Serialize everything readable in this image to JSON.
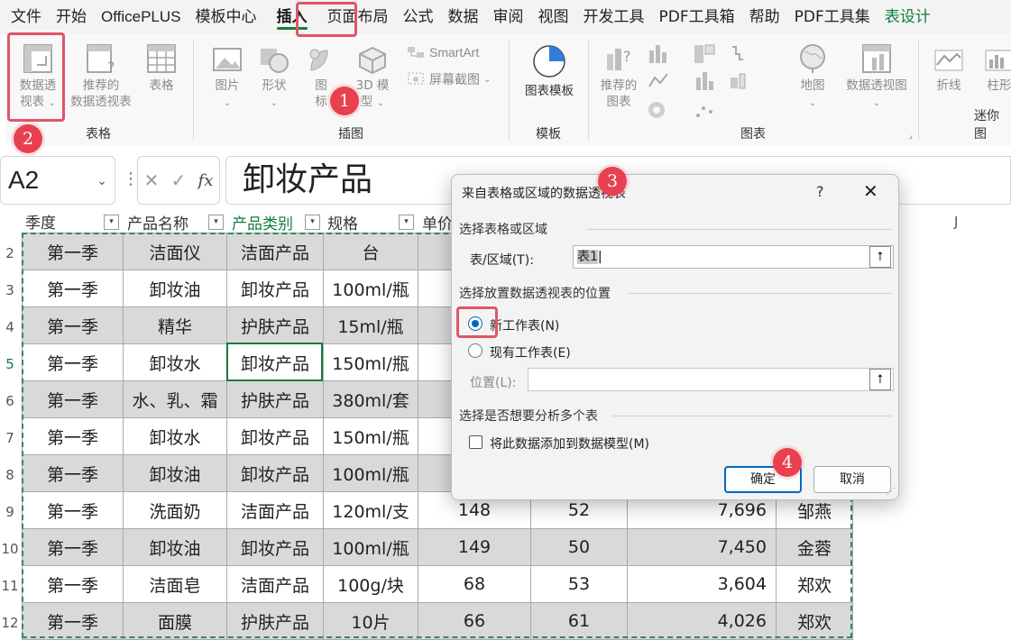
{
  "menu": {
    "items": [
      "文件",
      "开始",
      "OfficePLUS",
      "模板中心",
      "插入",
      "页面布局",
      "公式",
      "数据",
      "审阅",
      "视图",
      "开发工具",
      "PDF工具箱",
      "帮助",
      "PDF工具集",
      "表设计"
    ],
    "active": "插入"
  },
  "ribbon": {
    "table_group": {
      "label": "表格",
      "pivot_btn": [
        "数据透",
        "视表"
      ],
      "rec_pivot_btn": [
        "推荐的",
        "数据透视表"
      ],
      "table_btn": "表格"
    },
    "illustrations_group": {
      "label": "插图",
      "picture": "图片",
      "shapes": "形状",
      "icons": [
        "图",
        "标"
      ],
      "model3d": [
        "3D 模",
        "型"
      ],
      "smartart": "SmartArt",
      "screenshot": "屏幕截图"
    },
    "template_group": {
      "label": "模板",
      "chart_template": "图表模板"
    },
    "charts_group": {
      "label": "图表",
      "rec_charts": [
        "推荐的",
        "图表"
      ],
      "map": "地图",
      "pivot_chart": "数据透视图"
    },
    "sparkline_group": {
      "label": "迷你图",
      "line": "折线",
      "column": "柱形"
    }
  },
  "formula_bar": {
    "name_box": "A2",
    "fx": "fx",
    "content": "卸妆产品"
  },
  "sheet": {
    "col_headers": [
      "季度",
      "产品名称",
      "产品类别",
      "规格",
      "单价"
    ],
    "col_j": "J",
    "row_numbers": [
      "2",
      "3",
      "4",
      "5",
      "6",
      "7",
      "8",
      "9",
      "10",
      "11",
      "12"
    ],
    "rows": [
      [
        "第一季",
        "洁面仪",
        "洁面产品",
        "台",
        "",
        "",
        "",
        ""
      ],
      [
        "第一季",
        "卸妆油",
        "卸妆产品",
        "100ml/瓶",
        "",
        "",
        "",
        ""
      ],
      [
        "第一季",
        "精华",
        "护肤产品",
        "15ml/瓶",
        "",
        "",
        "",
        ""
      ],
      [
        "第一季",
        "卸妆水",
        "卸妆产品",
        "150ml/瓶",
        "",
        "",
        "",
        ""
      ],
      [
        "第一季",
        "水、乳、霜",
        "护肤产品",
        "380ml/套",
        "",
        "",
        "",
        ""
      ],
      [
        "第一季",
        "卸妆水",
        "卸妆产品",
        "150ml/瓶",
        "",
        "",
        "",
        ""
      ],
      [
        "第一季",
        "卸妆油",
        "卸妆产品",
        "100ml/瓶",
        "",
        "",
        "",
        ""
      ],
      [
        "第一季",
        "洗面奶",
        "洁面产品",
        "120ml/支",
        "148",
        "52",
        "7,696",
        "邹燕"
      ],
      [
        "第一季",
        "卸妆油",
        "卸妆产品",
        "100ml/瓶",
        "149",
        "50",
        "7,450",
        "金蓉"
      ],
      [
        "第一季",
        "洁面皂",
        "洁面产品",
        "100g/块",
        "68",
        "53",
        "3,604",
        "郑欢"
      ],
      [
        "第一季",
        "面膜",
        "护肤产品",
        "10片",
        "66",
        "61",
        "4,026",
        "郑欢"
      ]
    ]
  },
  "dialog": {
    "title": "来自表格或区域的数据透视表",
    "help": "?",
    "close": "✕",
    "section1": "选择表格或区域",
    "range_label": "表/区域(T):",
    "range_value": "表1",
    "section2": "选择放置数据透视表的位置",
    "opt_new": "新工作表(N)",
    "opt_existing": "现有工作表(E)",
    "location_label": "位置(L):",
    "location_value": "",
    "section3": "选择是否想要分析多个表",
    "checkbox_label": "将此数据添加到数据模型(M)",
    "ok": "确定",
    "cancel": "取消",
    "up_arrow": "⭡"
  },
  "annotations": [
    "1",
    "2",
    "3",
    "4"
  ],
  "colors": {
    "accent_green": "#107c41",
    "annotation_red": "#e05568",
    "dialog_blue": "#0067c0"
  }
}
